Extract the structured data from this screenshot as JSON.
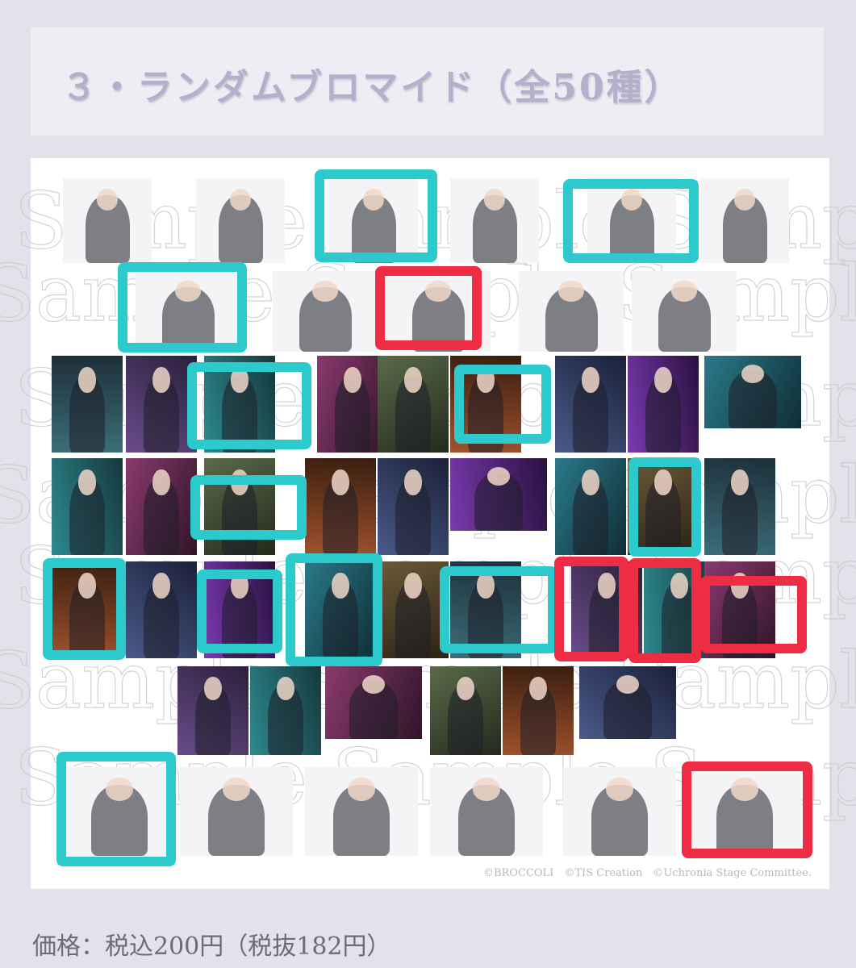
{
  "section": {
    "title": "３・ランダムブロマイド（全50種）"
  },
  "gallery": {
    "watermark": "Sample",
    "credits": "©BROCCOLI　©TIS Creation　©Uchronia Stage Committee.",
    "colors": {
      "teal_highlight": "#2cc9cd",
      "red_highlight": "#ee2d45",
      "panel": "#ffffff",
      "page_bg": "#e1e2ea"
    }
  },
  "price": {
    "text": "価格：税込200円（税抜182円）"
  }
}
